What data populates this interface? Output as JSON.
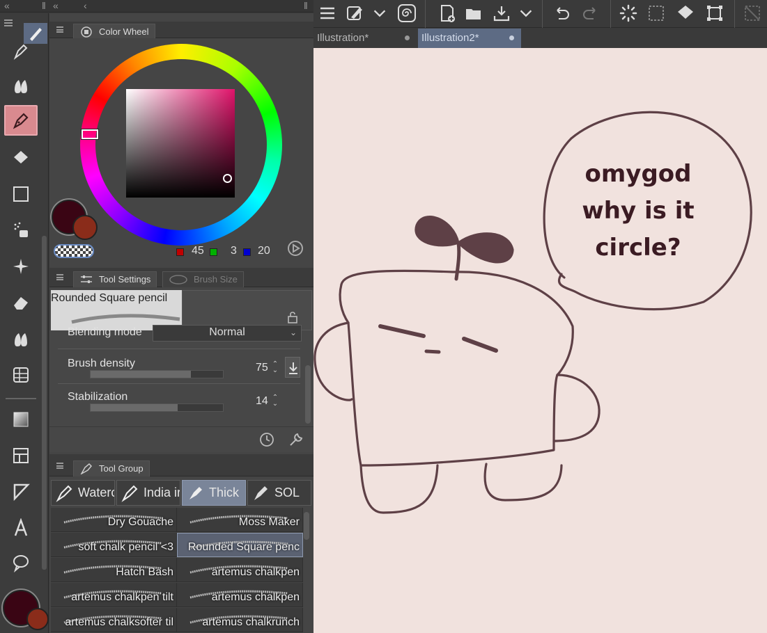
{
  "color_wheel": {
    "tab_label": "Color Wheel",
    "rgb": {
      "r": "45",
      "g": "3",
      "b": "20"
    },
    "main_color": "#3a0514",
    "sub_color": "#8a2c1a"
  },
  "tool_settings": {
    "tab_label": "Tool Settings",
    "tab_brush_size": "Brush Size",
    "brush_name": "Rounded Square pencil",
    "blending_label": "Blending mode",
    "blending_value": "Normal",
    "density_label": "Brush density",
    "density_value": "75",
    "density_fraction": 0.75,
    "stabilization_label": "Stabilization",
    "stabilization_value": "14",
    "stabilization_fraction": 0.65
  },
  "tool_group": {
    "tab_label": "Tool Group",
    "sub_tabs": [
      "Waterc",
      "India ir",
      "Thick",
      "SOL"
    ],
    "brushes": [
      "Dry Gouache",
      "Moss Maker",
      "soft chalk pencil <3",
      "Rounded Square penc",
      "Hatch Bash",
      "artemus chalkpen",
      "artemus chalkpen tilt",
      "artemus chalkpen",
      "artemus chalksofter til",
      "artemus chalkrunch"
    ]
  },
  "documents": {
    "tabs": [
      "Illustration*",
      "Illustration2*"
    ],
    "active": 1
  },
  "canvas_art": {
    "speech_lines": [
      "omygod",
      "why is it",
      "circle?"
    ],
    "ink_color": "#5e4046"
  },
  "colors": {
    "canvas_bg": "#f1e2de",
    "panel_bg": "#454545",
    "accent_tab": "#5d6b84"
  }
}
